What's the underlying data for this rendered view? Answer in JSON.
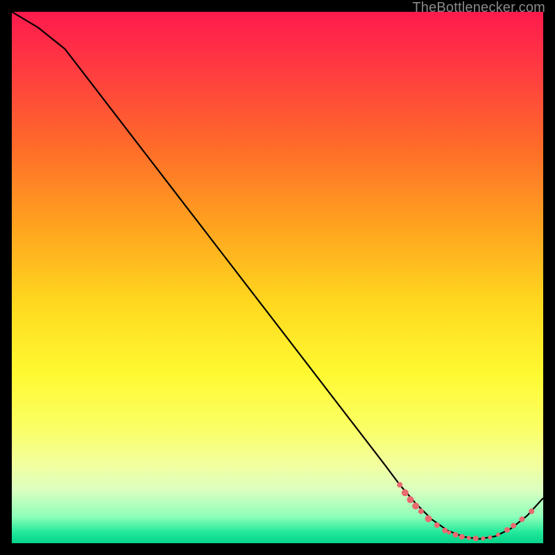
{
  "attribution": "TheBottlenecker.com",
  "chart_data": {
    "type": "line",
    "title": "",
    "xlabel": "",
    "ylabel": "",
    "xlim": [
      0,
      100
    ],
    "ylim": [
      0,
      100
    ],
    "series": [
      {
        "name": "bottleneck-curve",
        "x": [
          0,
          5,
          10,
          15,
          20,
          25,
          30,
          35,
          40,
          45,
          50,
          55,
          60,
          65,
          70,
          73,
          76,
          79,
          82,
          85,
          88,
          91,
          94,
          97,
          100
        ],
        "y": [
          100,
          97,
          93,
          86.5,
          80,
          73.5,
          67,
          60.5,
          54,
          47.5,
          41,
          34.5,
          28,
          21.5,
          15,
          11,
          7.5,
          4.5,
          2.4,
          1.2,
          0.8,
          1.3,
          2.8,
          5.2,
          8.5
        ]
      }
    ],
    "markers": {
      "name": "highlight-dots",
      "points": [
        {
          "x": 73.0,
          "y": 11.0,
          "r": 4
        },
        {
          "x": 74.0,
          "y": 9.5,
          "r": 5
        },
        {
          "x": 75.0,
          "y": 8.2,
          "r": 5
        },
        {
          "x": 76.0,
          "y": 7.0,
          "r": 5
        },
        {
          "x": 77.0,
          "y": 6.0,
          "r": 4
        },
        {
          "x": 78.4,
          "y": 4.6,
          "r": 5
        },
        {
          "x": 80.0,
          "y": 3.4,
          "r": 4
        },
        {
          "x": 81.5,
          "y": 2.4,
          "r": 4
        },
        {
          "x": 82.3,
          "y": 2.0,
          "r": 3
        },
        {
          "x": 83.5,
          "y": 1.6,
          "r": 4
        },
        {
          "x": 84.7,
          "y": 1.2,
          "r": 4
        },
        {
          "x": 86.0,
          "y": 1.0,
          "r": 3
        },
        {
          "x": 87.3,
          "y": 0.9,
          "r": 4
        },
        {
          "x": 88.7,
          "y": 0.9,
          "r": 3
        },
        {
          "x": 90.0,
          "y": 1.1,
          "r": 3
        },
        {
          "x": 91.5,
          "y": 1.6,
          "r": 3
        },
        {
          "x": 93.2,
          "y": 2.5,
          "r": 4
        },
        {
          "x": 94.4,
          "y": 3.3,
          "r": 4
        },
        {
          "x": 96.0,
          "y": 4.5,
          "r": 4
        },
        {
          "x": 97.8,
          "y": 6.0,
          "r": 4
        }
      ]
    },
    "background": {
      "gradient_top": "#ff1a4d",
      "gradient_bottom": "#06d38b"
    }
  }
}
